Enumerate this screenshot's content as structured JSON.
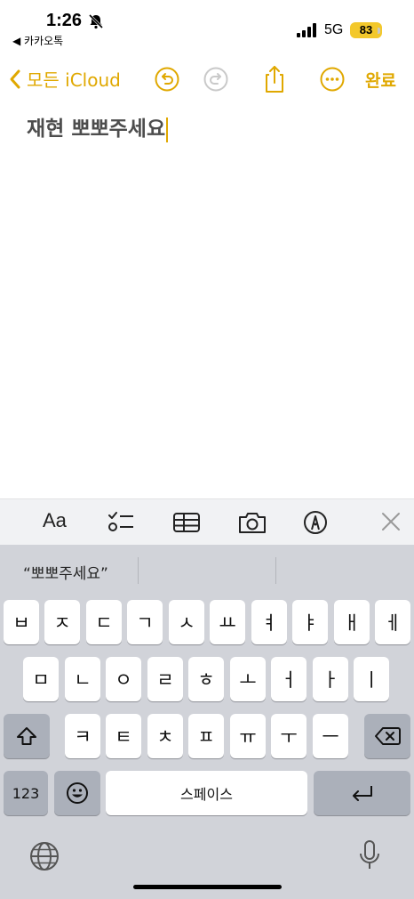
{
  "status_bar": {
    "time": "1:26",
    "back_app": "◀ 카카오톡",
    "network": "5G",
    "battery": "83"
  },
  "toolbar": {
    "back_label": "모든 iCloud",
    "done_label": "완료"
  },
  "note": {
    "text": "재현 뽀뽀주세요"
  },
  "format_bar": {
    "aa_label": "Aa",
    "icons": [
      "checklist-icon",
      "table-icon",
      "camera-icon",
      "markup-icon",
      "close-icon"
    ]
  },
  "suggestion": {
    "text": "“뽀뽀주세요”"
  },
  "keyboard": {
    "row1": [
      "ㅂ",
      "ㅈ",
      "ㄷ",
      "ㄱ",
      "ㅅ",
      "ㅛ",
      "ㅕ",
      "ㅑ",
      "ㅐ",
      "ㅔ"
    ],
    "row2": [
      "ㅁ",
      "ㄴ",
      "ㅇ",
      "ㄹ",
      "ㅎ",
      "ㅗ",
      "ㅓ",
      "ㅏ",
      "ㅣ"
    ],
    "row3": [
      "ㅋ",
      "ㅌ",
      "ㅊ",
      "ㅍ",
      "ㅠ",
      "ㅜ",
      "ㅡ"
    ],
    "numbers_label": "123",
    "space_label": "스페이스"
  },
  "colors": {
    "accent": "#e0a800",
    "keyboard_bg": "#d1d3d9",
    "key_bg": "#ffffff",
    "dark_key_bg": "#abb0ba"
  }
}
